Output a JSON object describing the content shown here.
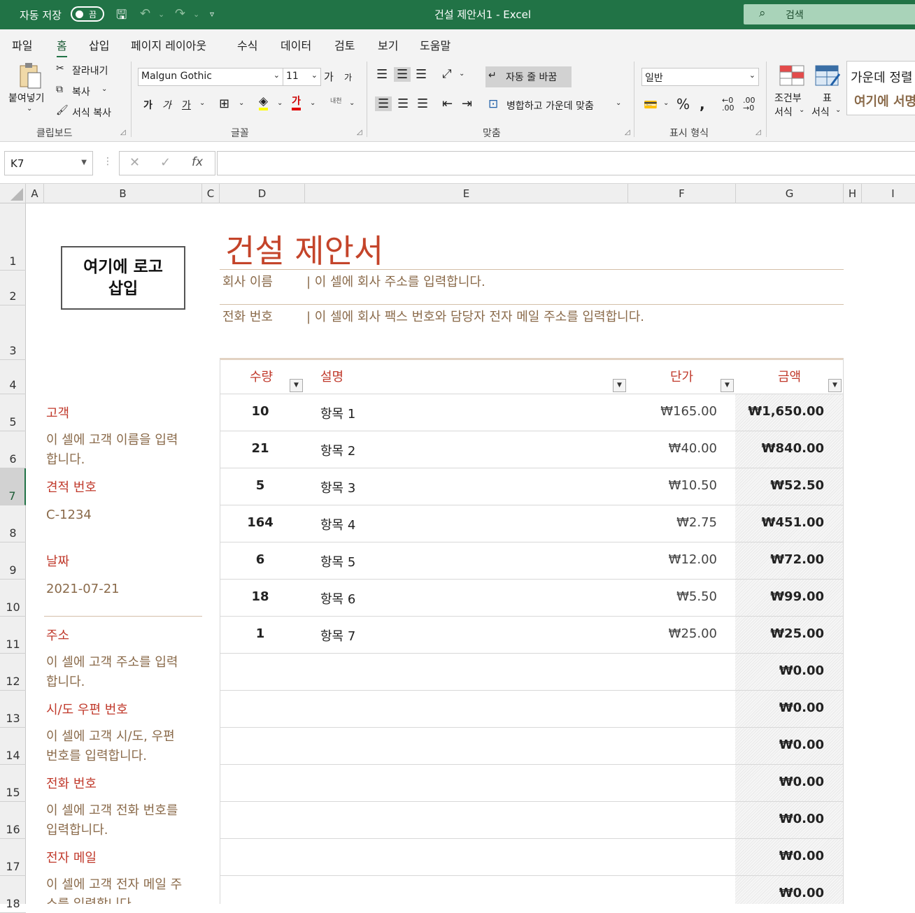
{
  "titlebar": {
    "autosave_label": "자동 저장",
    "autosave_state": "끔",
    "window_title": "건설 제안서1  -  Excel",
    "search_placeholder": "검색"
  },
  "tabs": [
    "파일",
    "홈",
    "삽입",
    "페이지 레이아웃",
    "수식",
    "데이터",
    "검토",
    "보기",
    "도움말"
  ],
  "active_tab": "홈",
  "ribbon": {
    "clipboard": {
      "paste": "붙여넣기",
      "cut": "잘라내기",
      "copy": "복사",
      "format_painter": "서식 복사",
      "group": "클립보드"
    },
    "font": {
      "font_name": "Malgun Gothic",
      "font_size": "11",
      "bold": "가",
      "italic": "가",
      "underline": "가",
      "grow": "가",
      "shrink": "가",
      "phonetic": "내천",
      "group": "글꼴"
    },
    "alignment": {
      "wrap_text": "자동 줄 바꿈",
      "merge_center": "병합하고 가운데 맞춤",
      "group": "맞춤"
    },
    "number": {
      "format": "일반",
      "group": "표시 형식"
    },
    "styles": {
      "conditional": "조건부\n서식",
      "conditional_1": "조건부",
      "conditional_2": "서식",
      "table_1": "표",
      "table_2": "서식",
      "center": "가운데 정렬",
      "style_sample": "여기에 서명"
    }
  },
  "formula_bar": {
    "name_box": "K7",
    "formula": ""
  },
  "columns": [
    "A",
    "B",
    "C",
    "D",
    "E",
    "F",
    "G",
    "H",
    "I"
  ],
  "rows": [
    "1",
    "2",
    "3",
    "4",
    "5",
    "6",
    "7",
    "8",
    "9",
    "10",
    "11",
    "12",
    "13",
    "14",
    "15",
    "16",
    "17",
    "18"
  ],
  "active_row": "7",
  "sheet": {
    "logo": "여기에 로고\n삽입",
    "logo_line1": "여기에 로고",
    "logo_line2": "삽입",
    "title": "건설 제안서",
    "company_label": "회사 이름",
    "company_value": "| 이 셀에 회사 주소를 입력합니다.",
    "phone_label": "전화 번호",
    "phone_value": "| 이 셀에 회사 팩스 번호와 담당자 전자 메일 주소를 입력합니다.",
    "customer_label": "고객",
    "customer_value_1": "이 셀에 고객 이름을 입력",
    "customer_value_2": "합니다.",
    "quote_label": "견적 번호",
    "quote_value": "C-1234",
    "date_label": "날짜",
    "date_value": "2021-07-21",
    "address_label": "주소",
    "address_value_1": "이 셀에 고객 주소를 입력",
    "address_value_2": "합니다.",
    "city_label": "시/도 우편 번호",
    "city_value_1": "이 셀에 고객 시/도, 우편",
    "city_value_2": "번호를 입력합니다.",
    "cust_phone_label": "전화 번호",
    "cust_phone_value_1": "이 셀에 고객 전화 번호를",
    "cust_phone_value_2": "입력합니다.",
    "email_label": "전자 메일",
    "email_value_1": "이 셀에 고객 전자 메일 주",
    "email_value_2": "소를 입력합니다."
  },
  "table": {
    "headers": {
      "qty": "수량",
      "desc": "설명",
      "price": "단가",
      "amount": "금액"
    },
    "rows": [
      {
        "qty": "10",
        "desc": "항목 1",
        "price": "₩165.00",
        "amount": "₩1,650.00"
      },
      {
        "qty": "21",
        "desc": "항목 2",
        "price": "₩40.00",
        "amount": "₩840.00"
      },
      {
        "qty": "5",
        "desc": "항목 3",
        "price": "₩10.50",
        "amount": "₩52.50"
      },
      {
        "qty": "164",
        "desc": "항목 4",
        "price": "₩2.75",
        "amount": "₩451.00"
      },
      {
        "qty": "6",
        "desc": "항목 5",
        "price": "₩12.00",
        "amount": "₩72.00"
      },
      {
        "qty": "18",
        "desc": "항목 6",
        "price": "₩5.50",
        "amount": "₩99.00"
      },
      {
        "qty": "1",
        "desc": "항목 7",
        "price": "₩25.00",
        "amount": "₩25.00"
      },
      {
        "qty": "",
        "desc": "",
        "price": "",
        "amount": "₩0.00"
      },
      {
        "qty": "",
        "desc": "",
        "price": "",
        "amount": "₩0.00"
      },
      {
        "qty": "",
        "desc": "",
        "price": "",
        "amount": "₩0.00"
      },
      {
        "qty": "",
        "desc": "",
        "price": "",
        "amount": "₩0.00"
      },
      {
        "qty": "",
        "desc": "",
        "price": "",
        "amount": "₩0.00"
      },
      {
        "qty": "",
        "desc": "",
        "price": "",
        "amount": "₩0.00"
      },
      {
        "qty": "",
        "desc": "",
        "price": "",
        "amount": "₩0.00"
      }
    ]
  }
}
